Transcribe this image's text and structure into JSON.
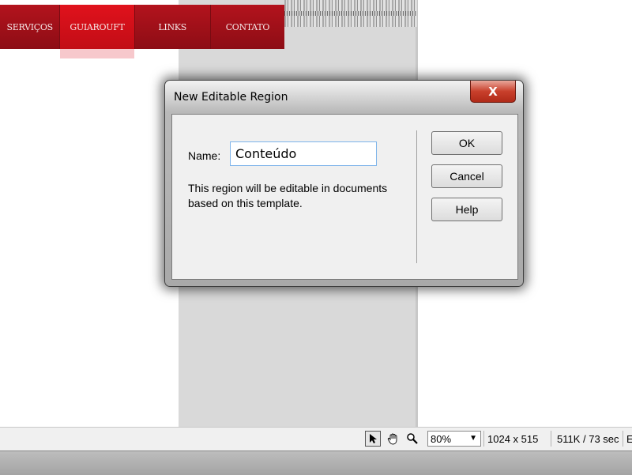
{
  "nav": {
    "items": [
      {
        "label": "SERVIÇOS"
      },
      {
        "label": "GUIAROUFT"
      },
      {
        "label": "LINKS"
      },
      {
        "label": "CONTATO"
      }
    ]
  },
  "dialog": {
    "title": "New Editable Region",
    "close_label": "X",
    "name_label": "Name:",
    "name_value": "Conteúdo",
    "description": "This region will be editable in documents based on this template.",
    "buttons": {
      "ok": "OK",
      "cancel": "Cancel",
      "help": "Help"
    }
  },
  "statusbar": {
    "icons": [
      "pointer-icon",
      "hand-icon",
      "zoom-icon"
    ],
    "zoom": "80%",
    "dimensions": "1024 x 515",
    "filesize": "511K / 73 sec",
    "trailing": "E"
  },
  "colors": {
    "nav_red": "#a01018",
    "nav_active": "#d8101a",
    "close_red": "#c9402c",
    "focus_border": "#7eb4ea"
  }
}
